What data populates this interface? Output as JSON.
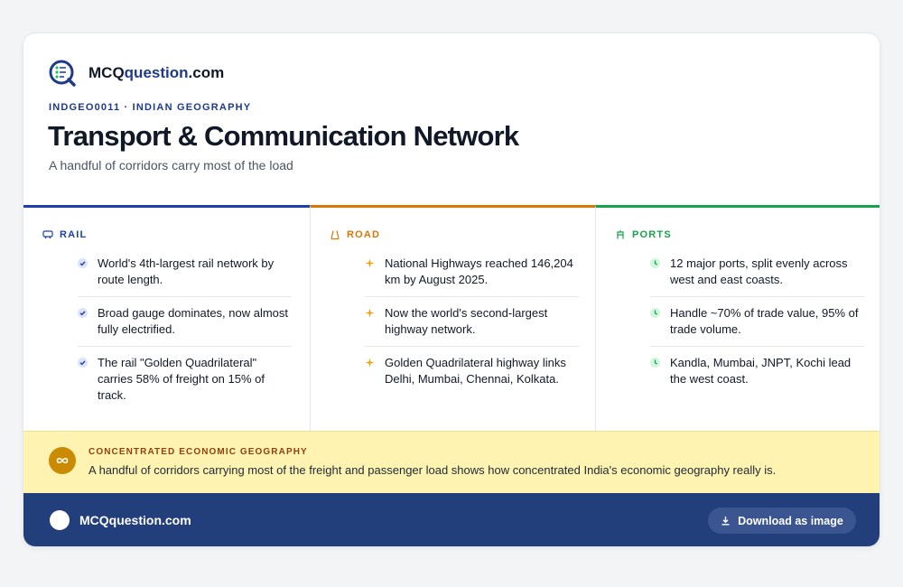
{
  "brand": {
    "name_main": "MCQ",
    "name_accent": "question",
    "name_suffix": ".com",
    "logo_icon": "quiz-checklist-icon"
  },
  "header": {
    "eyebrow": "INDGEO0011 · INDIAN GEOGRAPHY",
    "title": "Transport & Communication Network",
    "subtitle": "A handful of corridors carry most of the load"
  },
  "columns": [
    {
      "label": "RAIL",
      "icon": "train-icon",
      "color": "#1e40af",
      "bullet_icon": "check-icon",
      "items": [
        "World's 4th-largest rail network by route length.",
        "Broad gauge dominates, now almost fully electrified.",
        "The rail \"Golden Quadrilateral\" carries 58% of freight on 15% of track."
      ]
    },
    {
      "label": "ROAD",
      "icon": "road-icon",
      "color": "#d97706",
      "bullet_icon": "sparkle-icon",
      "items": [
        "National Highways reached 146,204 km by August 2025.",
        "Now the world's second-largest highway network.",
        "Golden Quadrilateral highway links Delhi, Mumbai, Chennai, Kolkata."
      ]
    },
    {
      "label": "PORTS",
      "icon": "anchor-icon",
      "color": "#16a34a",
      "bullet_icon": "clock-icon",
      "items": [
        "12 major ports, split evenly across west and east coasts.",
        "Handle ~70% of trade value, 95% of trade volume.",
        "Kandla, Mumbai, JNPT, Kochi lead the west coast."
      ]
    }
  ],
  "callout": {
    "icon": "infinity-icon",
    "label": "CONCENTRATED ECONOMIC GEOGRAPHY",
    "text": "A handful of corridors carrying most of the freight and passenger load shows how concentrated India's economic geography really is."
  },
  "footer": {
    "brand": "MCQquestion.com",
    "download_label": "Download as image",
    "download_icon": "download-icon"
  },
  "colors": {
    "brand_navy": "#233f7b",
    "callout_bg": "#fef3b0",
    "accent_blue": "#1e3a8a"
  }
}
